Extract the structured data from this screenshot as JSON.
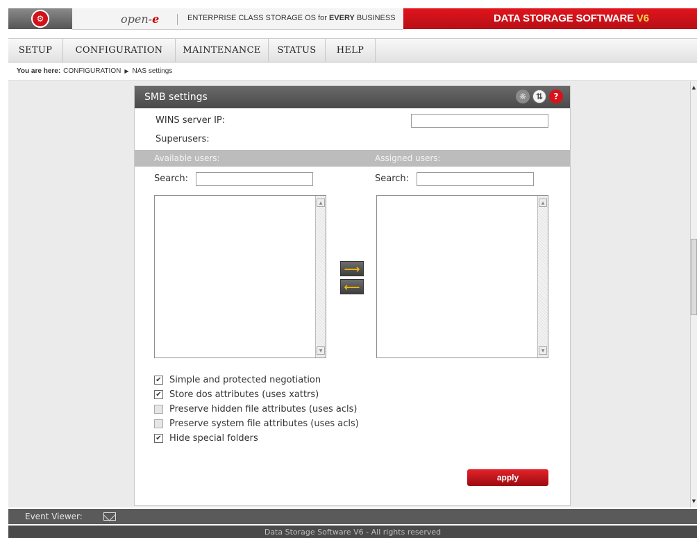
{
  "header": {
    "brand": "open-",
    "brand_accent": "e",
    "tagline_prefix": "ENTERPRISE CLASS STORAGE OS for ",
    "tagline_bold": "EVERY",
    "tagline_suffix": " BUSINESS",
    "product": "DATA STORAGE SOFTWARE ",
    "product_version": "V6",
    "logo_icon": "wrench-icon"
  },
  "menu": {
    "items": [
      {
        "label": "SETUP"
      },
      {
        "label": "CONFIGURATION"
      },
      {
        "label": "MAINTENANCE"
      },
      {
        "label": "STATUS"
      },
      {
        "label": "HELP"
      }
    ]
  },
  "breadcrumb": {
    "prefix": "You are here:",
    "section": "CONFIGURATION",
    "page": "NAS settings"
  },
  "panel": {
    "title": "SMB settings",
    "icons": [
      "gear-icon",
      "refresh-icon",
      "help-icon"
    ],
    "wins_label": "WINS server IP:",
    "wins_value": "",
    "superusers_label": "Superusers:",
    "available_label": "Available users:",
    "assigned_label": "Assigned users:",
    "search_label": "Search:",
    "search_available_value": "",
    "search_assigned_value": "",
    "available_users": [],
    "assigned_users": [],
    "checkboxes": [
      {
        "label": "Simple and protected negotiation",
        "checked": true,
        "enabled": true
      },
      {
        "label": "Store dos attributes (uses xattrs)",
        "checked": true,
        "enabled": true
      },
      {
        "label": "Preserve hidden file attributes (uses acls)",
        "checked": false,
        "enabled": false
      },
      {
        "label": "Preserve system file attributes (uses acls)",
        "checked": false,
        "enabled": false
      },
      {
        "label": "Hide special folders",
        "checked": true,
        "enabled": true
      }
    ],
    "apply_label": "apply"
  },
  "event_viewer": {
    "label": "Event Viewer:"
  },
  "footer": {
    "text": "Data Storage Software V6 - All rights reserved"
  },
  "colors": {
    "brand_red": "#d0121b",
    "panel_header": "#555555",
    "users_header": "#bcbcbc",
    "accent_yellow": "#f5b800"
  }
}
